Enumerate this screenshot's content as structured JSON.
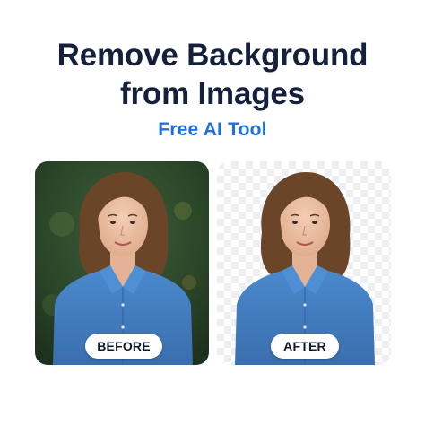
{
  "header": {
    "title_line1": "Remove Background",
    "title_line2": "from Images",
    "subtitle": "Free AI Tool"
  },
  "comparison": {
    "before_label": "BEFORE",
    "after_label": "AFTER"
  },
  "colors": {
    "title": "#15213a",
    "accent": "#1f6fe0",
    "shirt": "#3f7dc1",
    "background_green": "#2c4a2c"
  }
}
